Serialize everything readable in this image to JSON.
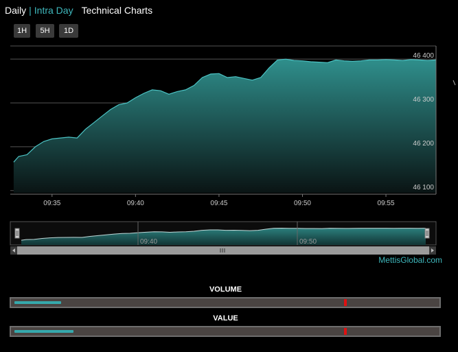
{
  "tabs": {
    "daily": "Daily",
    "separator": "|",
    "intraday": "Intra Day",
    "technical": "Technical Charts"
  },
  "range_buttons": [
    "1H",
    "5H",
    "1D"
  ],
  "brand": "MettisGlobal.com",
  "colors": {
    "accent": "#3fb8bd",
    "area_top": "#2f8f8c",
    "marker": "#e01010",
    "background": "#000000"
  },
  "navigator": {
    "labels": [
      "09:40",
      "09:50"
    ],
    "scrollbar_grip_icon": "grip-lines-icon",
    "left_arrow_icon": "caret-left-icon",
    "right_arrow_icon": "caret-right-icon"
  },
  "meters": {
    "volume": {
      "title": "VOLUME",
      "fill_fraction": 0.11,
      "marker_fraction": 0.79
    },
    "value": {
      "title": "VALUE",
      "fill_fraction": 0.14,
      "marker_fraction": 0.79
    }
  },
  "chart_data": {
    "type": "area",
    "xlabel": "",
    "ylabel": "",
    "x_start": "09:32:30",
    "x_end": "09:58:00",
    "xlim_minutes": [
      32.5,
      58.0
    ],
    "ylim": [
      46095,
      46430
    ],
    "x_ticks": [
      "09:35",
      "09:40",
      "09:45",
      "09:50",
      "09:55"
    ],
    "y_ticks": [
      "46 100",
      "46 200",
      "46 300",
      "46 400"
    ],
    "grid": "horizontal",
    "legend": "none",
    "series": [
      {
        "x": [
          32.7,
          33.0,
          33.5,
          34.0,
          34.5,
          35.0,
          35.5,
          36.0,
          36.5,
          37.0,
          37.5,
          38.0,
          38.5,
          39.0,
          39.5,
          40.0,
          40.5,
          41.0,
          41.5,
          42.0,
          42.5,
          43.0,
          43.5,
          44.0,
          44.5,
          45.0,
          45.5,
          46.0,
          46.5,
          47.0,
          47.5,
          48.0,
          48.5,
          49.0,
          49.5,
          50.0,
          50.5,
          51.0,
          51.5,
          52.0,
          52.5,
          53.0,
          53.5,
          54.0,
          54.5,
          55.0,
          55.5,
          56.0,
          56.5,
          57.0,
          57.5,
          58.0
        ],
        "y": [
          46165,
          46178,
          46182,
          46200,
          46212,
          46218,
          46220,
          46222,
          46220,
          46240,
          46255,
          46270,
          46285,
          46296,
          46300,
          46312,
          46322,
          46330,
          46328,
          46320,
          46326,
          46330,
          46340,
          46358,
          46366,
          46367,
          46358,
          46360,
          46356,
          46352,
          46358,
          46380,
          46398,
          46400,
          46397,
          46396,
          46394,
          46393,
          46392,
          46398,
          46396,
          46395,
          46396,
          46398,
          46398,
          46399,
          46398,
          46397,
          46399,
          46398,
          46397,
          46398
        ]
      }
    ]
  }
}
